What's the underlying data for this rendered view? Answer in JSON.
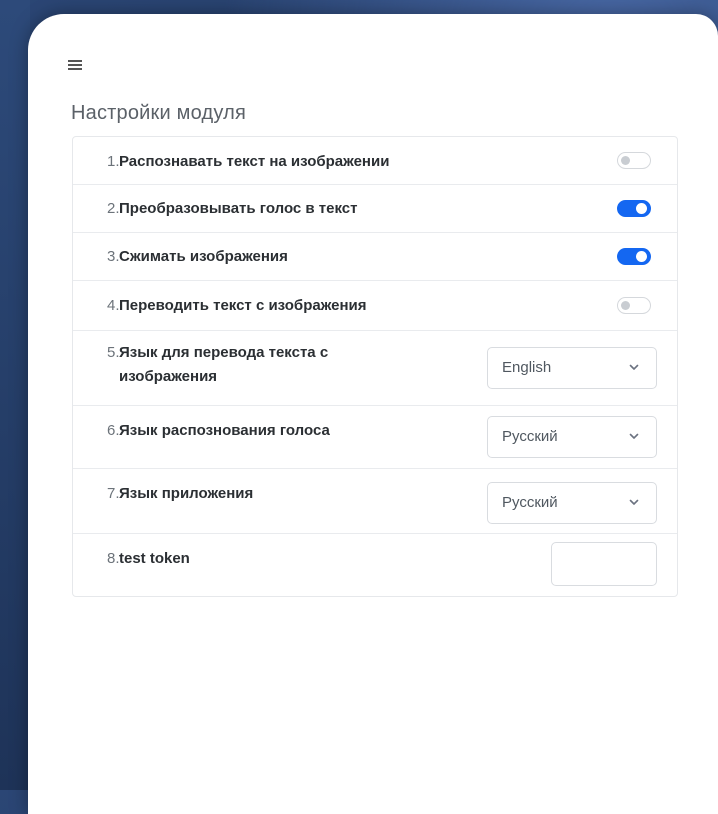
{
  "page": {
    "title": "Настройки модуля"
  },
  "settings": [
    {
      "num": "1.",
      "label": "Распознавать текст на изображении",
      "control": "toggle",
      "on": false
    },
    {
      "num": "2.",
      "label": "Преобразовывать голос в текст",
      "control": "toggle",
      "on": true
    },
    {
      "num": "3.",
      "label": "Сжимать изображения",
      "control": "toggle",
      "on": true
    },
    {
      "num": "4.",
      "label": "Переводить текст с изображения",
      "control": "toggle",
      "on": false
    },
    {
      "num": "5.",
      "label_line1": "Язык для перевода текста с",
      "label_line2": "изображения",
      "control": "select",
      "value": "English"
    },
    {
      "num": "6.",
      "label": "Язык распознования голоса",
      "control": "select",
      "value": "Русский"
    },
    {
      "num": "7.",
      "label": "Язык приложения",
      "control": "select",
      "value": "Русский"
    },
    {
      "num": "8.",
      "label": "test token",
      "control": "text",
      "value": ""
    }
  ],
  "icons": {
    "menu": "hamburger-menu-icon",
    "dropdown": "chevron-down-icon"
  },
  "colors": {
    "accent": "#1467f1",
    "toggle_off": "#c9cdd2"
  }
}
